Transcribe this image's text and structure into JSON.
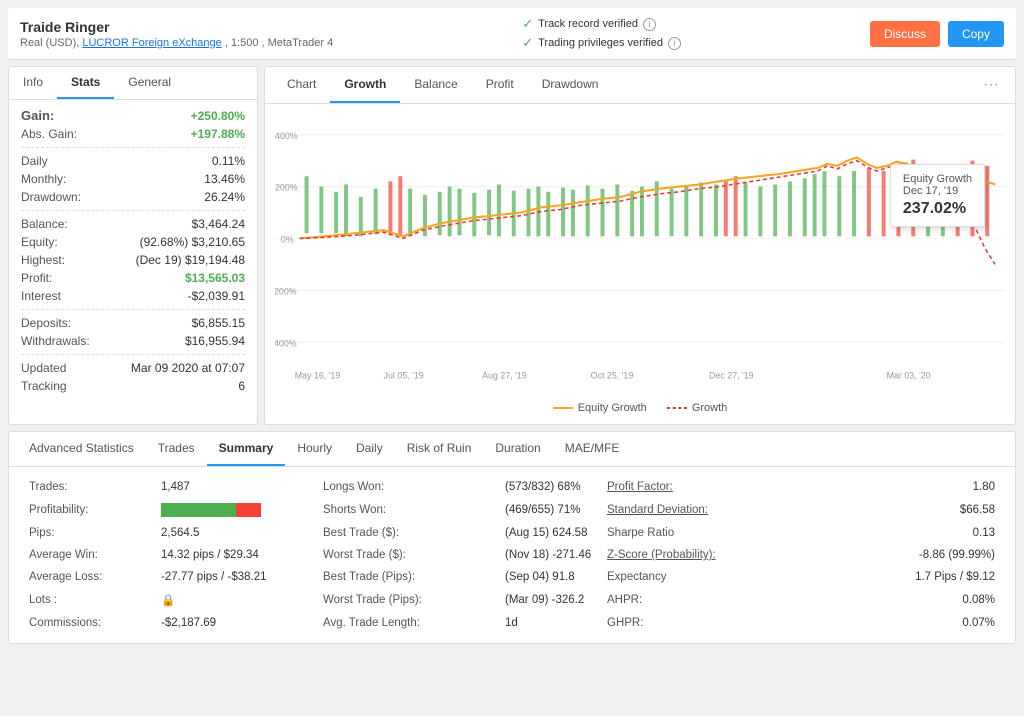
{
  "header": {
    "title": "Traide Ringer",
    "subtitle_prefix": "Real (USD),",
    "broker_link": "LUCROR Foreign eXchange",
    "subtitle_suffix": ", 1:500 , MetaTrader 4",
    "verified1": "Track record verified",
    "verified2": "Trading privileges verified",
    "btn_discuss": "Discuss",
    "btn_copy": "Copy"
  },
  "left_panel": {
    "tabs": [
      "Info",
      "Stats",
      "General"
    ],
    "active_tab": "Stats",
    "gain_label": "Gain:",
    "gain_value": "+250.80%",
    "abs_gain_label": "Abs. Gain:",
    "abs_gain_value": "+197.88%",
    "daily_label": "Daily",
    "daily_value": "0.11%",
    "monthly_label": "Monthly:",
    "monthly_value": "13.46%",
    "drawdown_label": "Drawdown:",
    "drawdown_value": "26.24%",
    "balance_label": "Balance:",
    "balance_value": "$3,464.24",
    "equity_label": "Equity:",
    "equity_value": "(92.68%) $3,210.65",
    "highest_label": "Highest:",
    "highest_value": "(Dec 19) $19,194.48",
    "profit_label": "Profit:",
    "profit_value": "$13,565.03",
    "interest_label": "Interest",
    "interest_value": "-$2,039.91",
    "deposits_label": "Deposits:",
    "deposits_value": "$6,855.15",
    "withdrawals_label": "Withdrawals:",
    "withdrawals_value": "$16,955.94",
    "updated_label": "Updated",
    "updated_value": "Mar 09 2020 at 07:07",
    "tracking_label": "Tracking",
    "tracking_value": "6"
  },
  "chart": {
    "tabs": [
      "Chart",
      "Growth",
      "Balance",
      "Profit",
      "Drawdown"
    ],
    "active_tab": "Growth",
    "tooltip_title": "Equity Growth",
    "tooltip_date": "Dec 17, '19",
    "tooltip_value": "237.02%",
    "legend_equity": "Equity Growth",
    "legend_growth": "Growth",
    "x_labels": [
      "May 16, '19",
      "Jul 05, '19",
      "Aug 27, '19",
      "Oct 25, '19",
      "Dec 27, '19",
      "Mar 03, '20"
    ],
    "y_labels": [
      "400%",
      "200%",
      "0%",
      "-200%",
      "-400%"
    ]
  },
  "bottom": {
    "tabs": [
      "Advanced Statistics",
      "Trades",
      "Summary",
      "Hourly",
      "Daily",
      "Risk of Ruin",
      "Duration",
      "MAE/MFE"
    ],
    "active_tab": "Summary",
    "rows": [
      {
        "label1": "Trades:",
        "val1": "1,487",
        "label2": "Longs Won:",
        "val2": "(573/832) 68%",
        "label3": "Profit Factor:",
        "val3": "1.80"
      },
      {
        "label1": "Profitability:",
        "val1": "bar",
        "label2": "Shorts Won:",
        "val2": "(469/655) 71%",
        "label3": "Standard Deviation:",
        "val3": "$66.58"
      },
      {
        "label1": "Pips:",
        "val1": "2,564.5",
        "label2": "Best Trade ($):",
        "val2": "(Aug 15) 624.58",
        "label3": "Sharpe Ratio",
        "val3": "0.13"
      },
      {
        "label1": "Average Win:",
        "val1": "14.32 pips / $29.34",
        "label2": "Worst Trade ($):",
        "val2": "(Nov 18) -271.46",
        "label3": "Z-Score (Probability):",
        "val3": "-8.86 (99.99%)"
      },
      {
        "label1": "Average Loss:",
        "val1": "-27.77 pips / -$38.21",
        "label2": "Best Trade (Pips):",
        "val2": "(Sep 04) 91.8",
        "label3": "Expectancy",
        "val3": "1.7 Pips / $9.12"
      },
      {
        "label1": "Lots :",
        "val1": "lock",
        "label2": "Worst Trade (Pips):",
        "val2": "(Mar 09) -326.2",
        "label3": "AHPR:",
        "val3": "0.08%"
      },
      {
        "label1": "Commissions:",
        "val1": "-$2,187.69",
        "label2": "Avg. Trade Length:",
        "val2": "1d",
        "label3": "GHPR:",
        "val3": "0.07%"
      }
    ]
  }
}
